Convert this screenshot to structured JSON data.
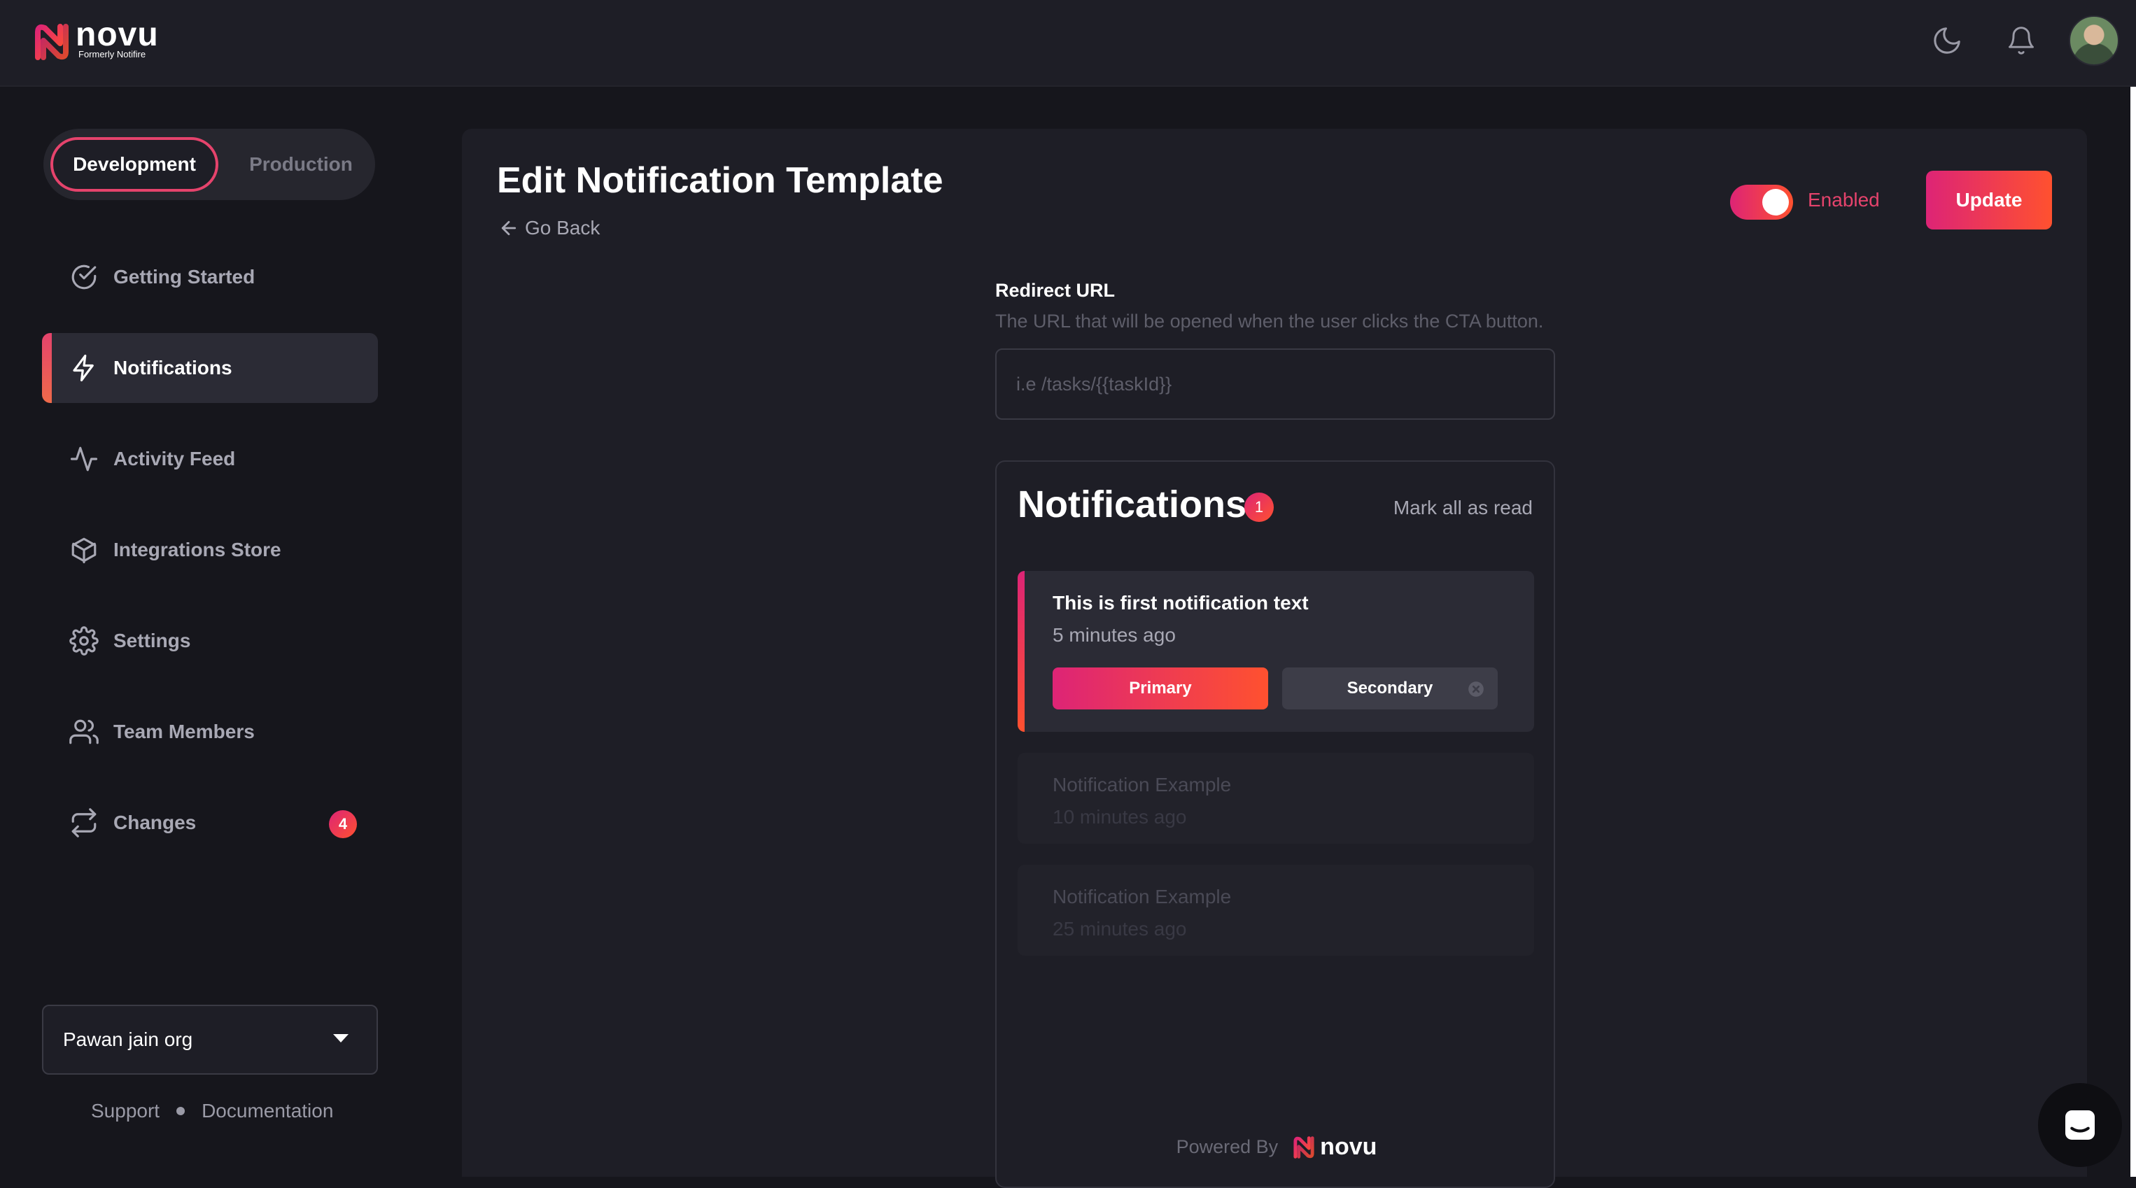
{
  "brand": {
    "name": "novu",
    "subtitle": "Formerly Notifire",
    "gradient_start": "#dd2476",
    "gradient_end": "#ff512f"
  },
  "header": {
    "icons": [
      "moon-icon",
      "bell-icon",
      "avatar"
    ]
  },
  "environment": {
    "options": [
      "Development",
      "Production"
    ],
    "selected": "Development"
  },
  "sidebar": {
    "items": [
      {
        "label": "Getting Started",
        "icon": "check-circle-icon"
      },
      {
        "label": "Notifications",
        "icon": "bolt-icon",
        "active": true
      },
      {
        "label": "Activity Feed",
        "icon": "activity-icon"
      },
      {
        "label": "Integrations Store",
        "icon": "box-icon"
      },
      {
        "label": "Settings",
        "icon": "gear-icon"
      },
      {
        "label": "Team Members",
        "icon": "users-icon"
      },
      {
        "label": "Changes",
        "icon": "repeat-icon",
        "badge": "4"
      }
    ],
    "organization": "Pawan jain org",
    "links": [
      "Support",
      "Documentation"
    ]
  },
  "main": {
    "title": "Edit Notification Template",
    "go_back": "Go Back",
    "toggle_label": "Enabled",
    "toggle_on": true,
    "update_label": "Update",
    "redirect": {
      "label": "Redirect URL",
      "help": "The URL that will be opened when the user clicks the CTA button.",
      "placeholder": "i.e /tasks/{{taskId}}",
      "value": ""
    }
  },
  "inbox": {
    "title": "Notifications",
    "unread_count": "1",
    "mark_all": "Mark all as read",
    "items": [
      {
        "text": "This is first notification text",
        "time": "5 minutes ago",
        "primary": "Primary",
        "secondary": "Secondary"
      },
      {
        "text": "Notification Example",
        "time": "10 minutes ago"
      },
      {
        "text": "Notification Example",
        "time": "25 minutes ago"
      }
    ],
    "powered_by": "Powered By",
    "powered_brand": "novu"
  }
}
